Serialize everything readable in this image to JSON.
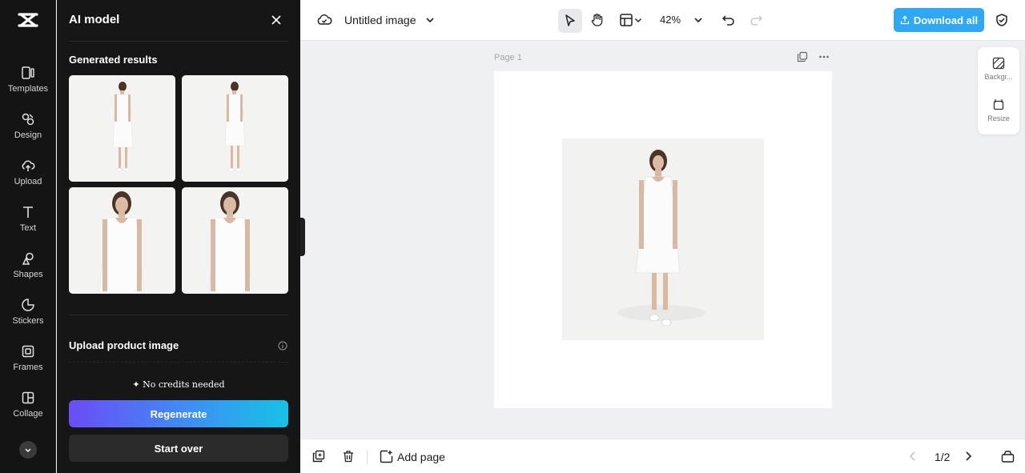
{
  "rail": {
    "items": [
      {
        "label": "Templates",
        "icon": "templates-icon"
      },
      {
        "label": "Design",
        "icon": "design-icon"
      },
      {
        "label": "Upload",
        "icon": "upload-icon"
      },
      {
        "label": "Text",
        "icon": "text-icon"
      },
      {
        "label": "Shapes",
        "icon": "shapes-icon"
      },
      {
        "label": "Stickers",
        "icon": "stickers-icon"
      },
      {
        "label": "Frames",
        "icon": "frames-icon"
      },
      {
        "label": "Collage",
        "icon": "collage-icon"
      }
    ]
  },
  "panel": {
    "title": "AI model",
    "generated_title": "Generated results",
    "upload_title": "Upload product image",
    "credits": "No credits needed",
    "regenerate_label": "Regenerate",
    "start_over_label": "Start over"
  },
  "topbar": {
    "title": "Untitled image",
    "zoom": "42%",
    "download_label": "Download all"
  },
  "canvas": {
    "page_label": "Page 1"
  },
  "right_tools": {
    "background_label": "Backgr...",
    "resize_label": "Resize"
  },
  "bottombar": {
    "add_page_label": "Add page",
    "page_indicator": "1/2"
  },
  "colors": {
    "accent": "#2fa8f3",
    "gradient_start": "#6b4cf6",
    "gradient_end": "#16c2e6"
  }
}
